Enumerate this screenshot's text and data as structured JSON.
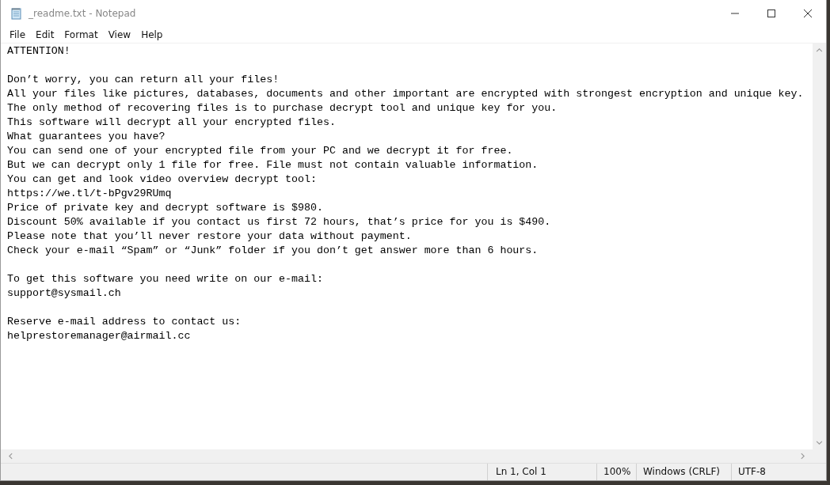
{
  "window": {
    "title": "_readme.txt - Notepad"
  },
  "menu": [
    "File",
    "Edit",
    "Format",
    "View",
    "Help"
  ],
  "document": {
    "paragraphs": [
      [
        "ATTENTION!"
      ],
      [
        "Don’t worry, you can return all your files!",
        "All your files like pictures, databases, documents and other important are encrypted with strongest encryption and unique key.",
        "The only method of recovering files is to purchase decrypt tool and unique key for you.",
        "This software will decrypt all your encrypted files.",
        "What guarantees you have?",
        "You can send one of your encrypted file from your PC and we decrypt it for free.",
        "But we can decrypt only 1 file for free. File must not contain valuable information.",
        "You can get and look video overview decrypt tool:",
        "https://we.tl/t-bPgv29RUmq",
        "Price of private key and decrypt software is $980.",
        "Discount 50% available if you contact us first 72 hours, that’s price for you is $490.",
        "Please note that you’ll never restore your data without payment.",
        "Check your e-mail “Spam” or “Junk” folder if you don’t get answer more than 6 hours."
      ],
      [
        "To get this software you need write on our e-mail:",
        "support@sysmail.ch"
      ],
      [
        "Reserve e-mail address to contact us:",
        "helprestoremanager@airmail.cc"
      ]
    ]
  },
  "status_bar": {
    "position": "Ln 1, Col 1",
    "zoom": "100%",
    "line_endings": "Windows (CRLF)",
    "encoding": "UTF-8"
  }
}
